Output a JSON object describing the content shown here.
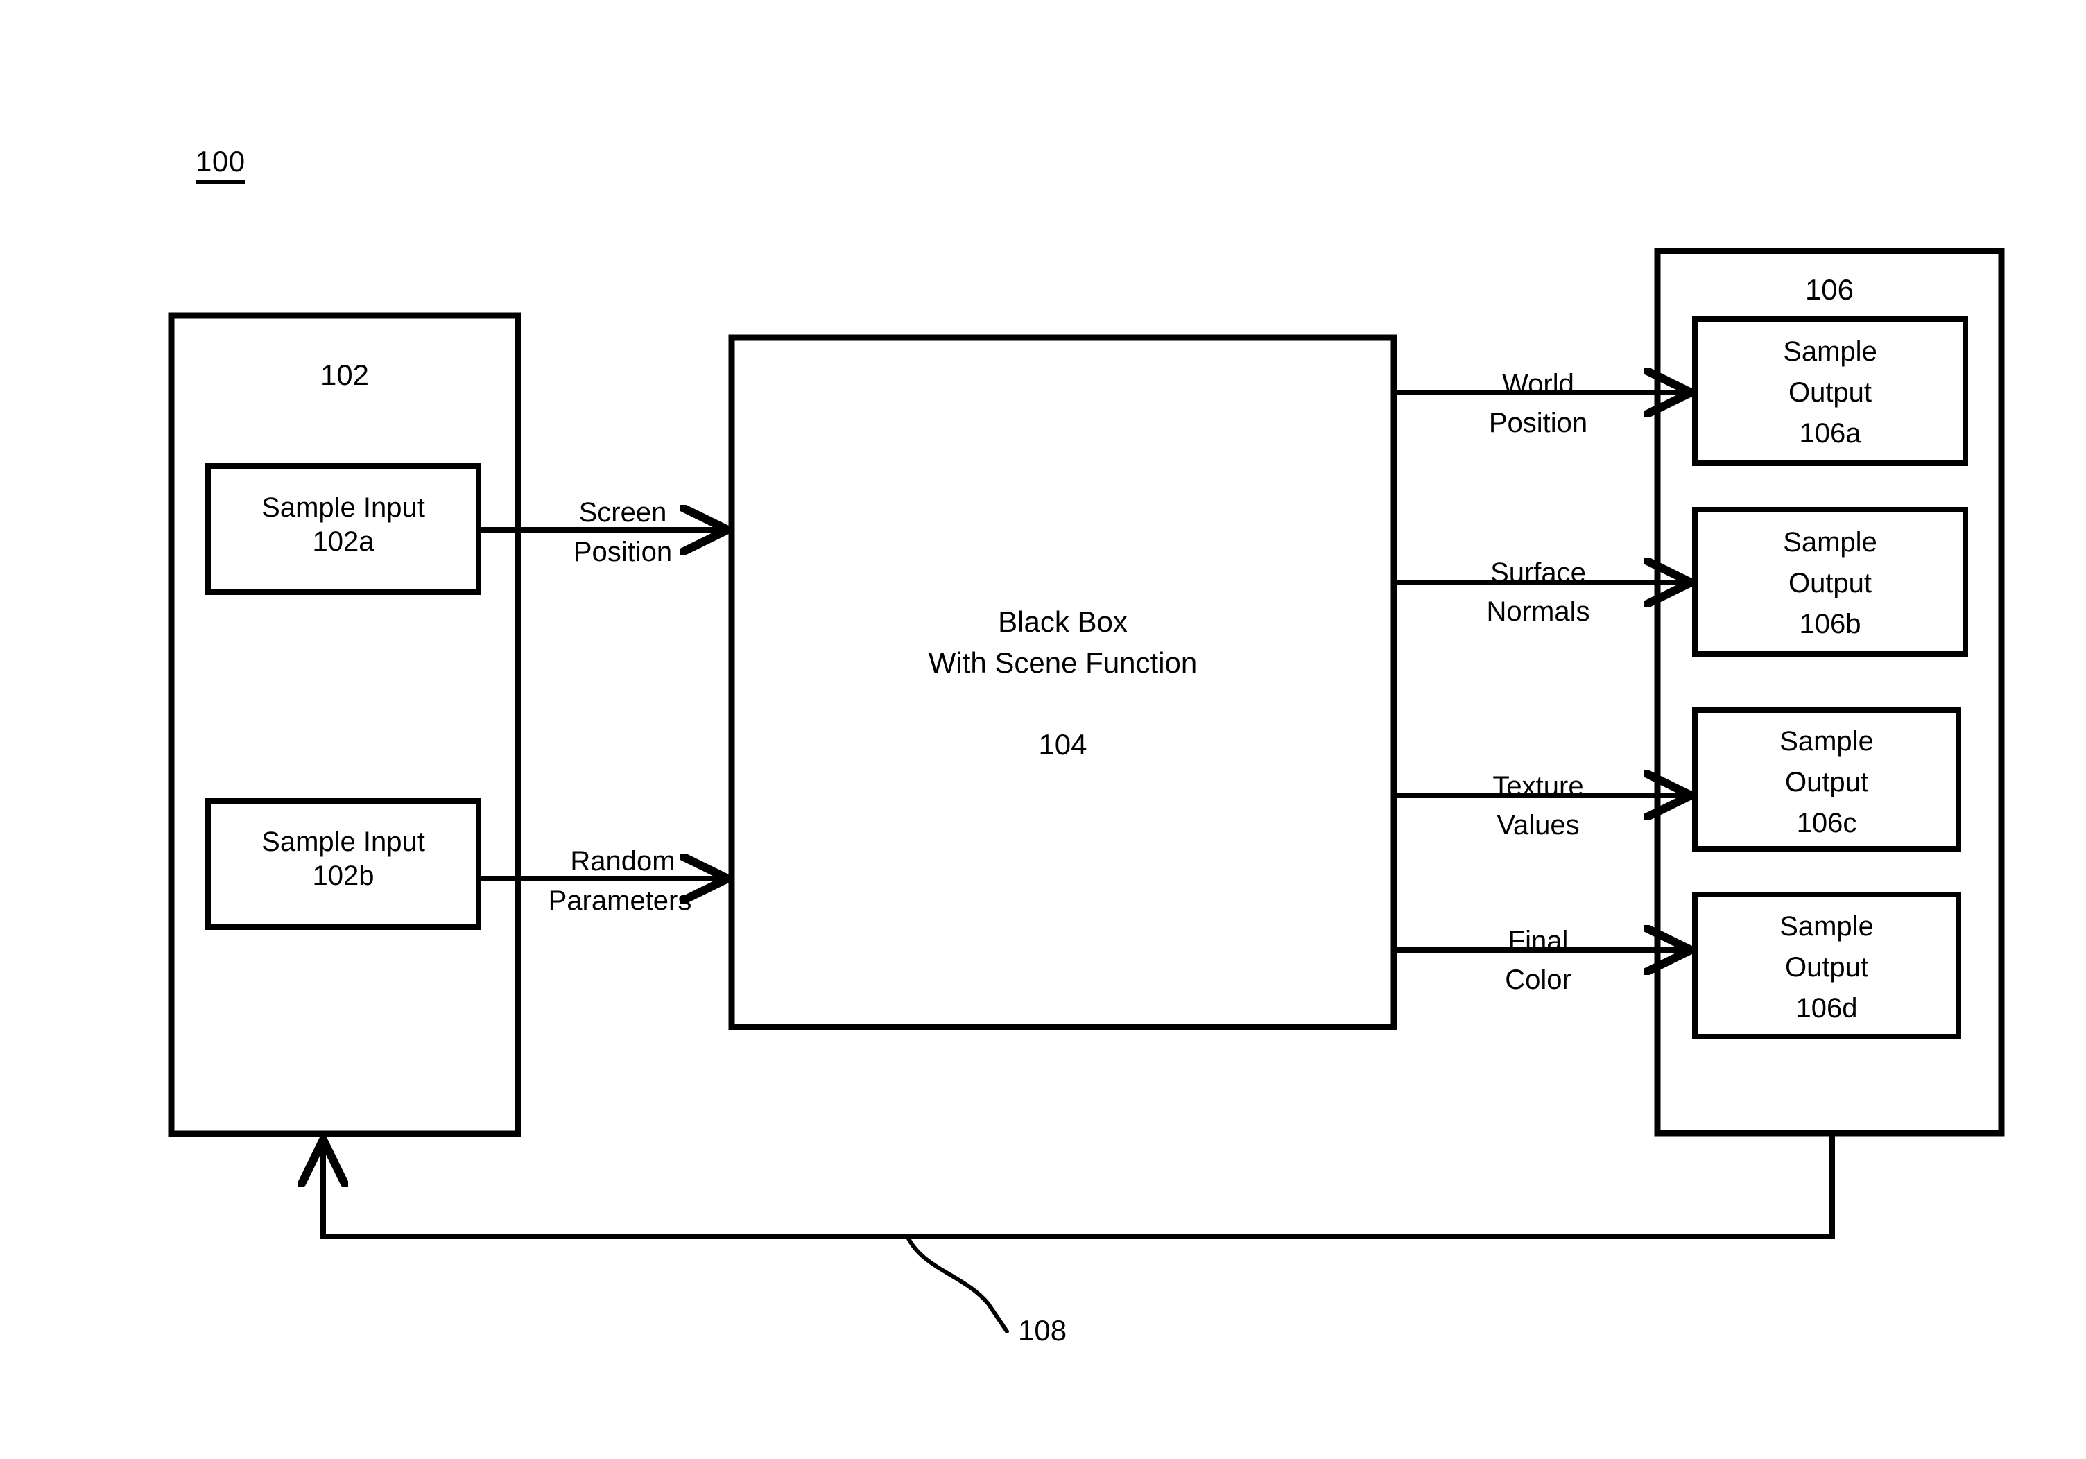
{
  "figure": {
    "number": "100",
    "feedback_ref": "108"
  },
  "input_group": {
    "ref": "102",
    "boxes": [
      {
        "title": "Sample Input",
        "ref": "102a"
      },
      {
        "title": "Sample Input",
        "ref": "102b"
      }
    ]
  },
  "processor": {
    "line1": "Black Box",
    "line2": "With Scene Function",
    "ref": "104"
  },
  "output_group": {
    "ref": "106",
    "boxes": [
      {
        "title": "Sample",
        "title2": "Output",
        "ref": "106a"
      },
      {
        "title": "Sample",
        "title2": "Output",
        "ref": "106b"
      },
      {
        "title": "Sample",
        "title2": "Output",
        "ref": "106c"
      },
      {
        "title": "Sample",
        "title2": "Output",
        "ref": "106d"
      }
    ]
  },
  "input_edges": [
    {
      "line1": "Screen",
      "line2": "Position"
    },
    {
      "line1": "Random",
      "line2": "Parameters"
    }
  ],
  "output_edges": [
    {
      "line1": "World",
      "line2": "Position"
    },
    {
      "line1": "Surface",
      "line2": "Normals"
    },
    {
      "line1": "Texture",
      "line2": "Values"
    },
    {
      "line1": "Final",
      "line2": "Color"
    }
  ],
  "colors": {
    "ink": "#000000",
    "paper": "#ffffff"
  }
}
